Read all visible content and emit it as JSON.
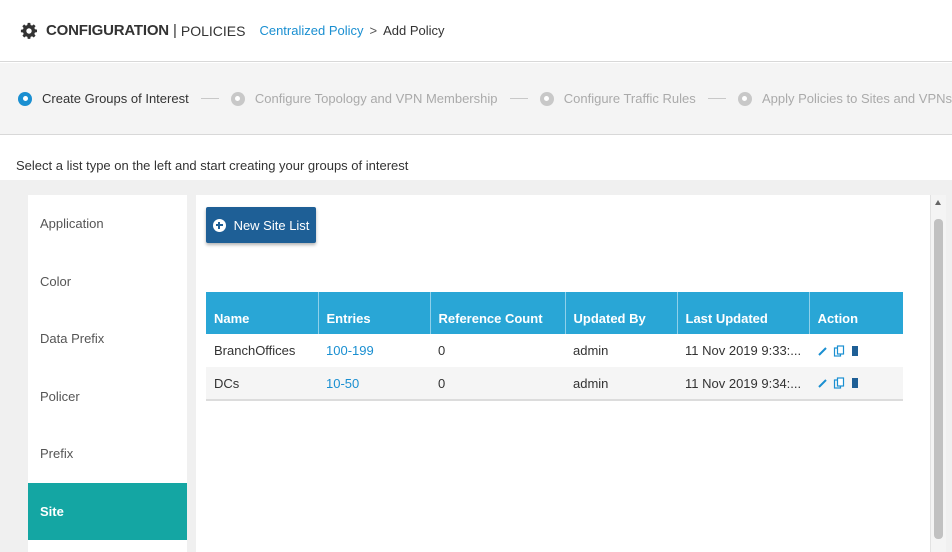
{
  "header": {
    "title_config": "CONFIGURATION",
    "title_sep": "|",
    "title_policies": "POLICIES",
    "breadcrumb_link": "Centralized Policy",
    "breadcrumb_arrow": ">",
    "breadcrumb_current": "Add Policy"
  },
  "stepper": {
    "steps": [
      {
        "label": "Create Groups of Interest",
        "active": true
      },
      {
        "label": "Configure Topology and VPN Membership",
        "active": false
      },
      {
        "label": "Configure Traffic Rules",
        "active": false
      },
      {
        "label": "Apply Policies to Sites and VPNs",
        "active": false
      }
    ]
  },
  "instruction": "Select a list type on the left and start creating your groups of interest",
  "sidebar": {
    "items": [
      {
        "label": "Application"
      },
      {
        "label": "Color"
      },
      {
        "label": "Data Prefix"
      },
      {
        "label": "Policer"
      },
      {
        "label": "Prefix"
      },
      {
        "label": "Site",
        "active": true
      }
    ]
  },
  "main": {
    "new_button_label": "New Site List",
    "table": {
      "headers": [
        "Name",
        "Entries",
        "Reference Count",
        "Updated By",
        "Last Updated",
        "Action"
      ],
      "rows": [
        {
          "name": "BranchOffices",
          "entries": "100-199",
          "reference_count": "0",
          "updated_by": "admin",
          "last_updated": "11 Nov 2019 9:33:..."
        },
        {
          "name": "DCs",
          "entries": "10-50",
          "reference_count": "0",
          "updated_by": "admin",
          "last_updated": "11 Nov 2019 9:34:..."
        }
      ],
      "action_icons": [
        "edit-icon",
        "copy-icon",
        "delete-icon"
      ]
    }
  },
  "colors": {
    "accent_blue": "#1a8fd1",
    "table_header": "#29a6d6",
    "active_sidebar": "#14a6a3",
    "button": "#1e5f96"
  }
}
